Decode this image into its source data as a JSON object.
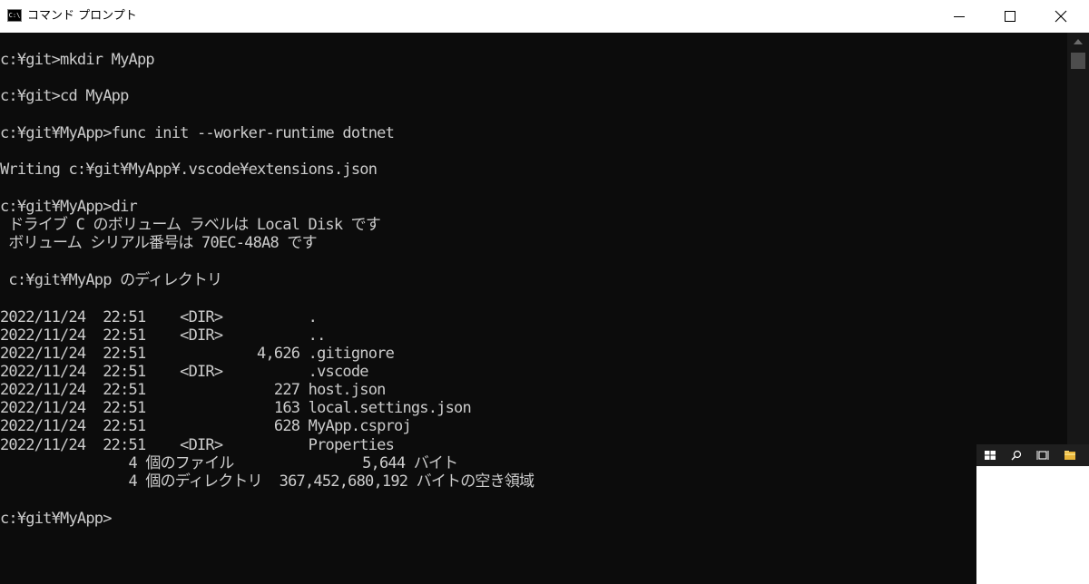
{
  "window": {
    "title": "コマンド プロンプト",
    "icon_label": "C:\\"
  },
  "console": {
    "lines": [
      "c:¥git>mkdir MyApp",
      "c:¥git>cd MyApp",
      "c:¥git¥MyApp>func init --worker-runtime dotnet",
      "Writing c:¥git¥MyApp¥.vscode¥extensions.json",
      "c:¥git¥MyApp>dir",
      " ドライブ C のボリューム ラベルは Local Disk です",
      " ボリューム シリアル番号は 70EC-48A8 です",
      " c:¥git¥MyApp のディレクトリ",
      "2022/11/24  22:51    <DIR>          .",
      "2022/11/24  22:51    <DIR>          ..",
      "2022/11/24  22:51             4,626 .gitignore",
      "2022/11/24  22:51    <DIR>          .vscode",
      "2022/11/24  22:51               227 host.json",
      "2022/11/24  22:51               163 local.settings.json",
      "2022/11/24  22:51               628 MyApp.csproj",
      "2022/11/24  22:51    <DIR>          Properties",
      "               4 個のファイル               5,644 バイト",
      "               4 個のディレクトリ  367,452,680,192 バイトの空き領域",
      "c:¥git¥MyApp>"
    ]
  },
  "taskbar": {
    "icons": [
      "windows-start-icon",
      "search-icon",
      "task-view-icon",
      "file-explorer-icon"
    ]
  },
  "colors": {
    "console_bg": "#0c0c0c",
    "console_text": "#cccccc",
    "titlebar_bg": "#ffffff"
  }
}
